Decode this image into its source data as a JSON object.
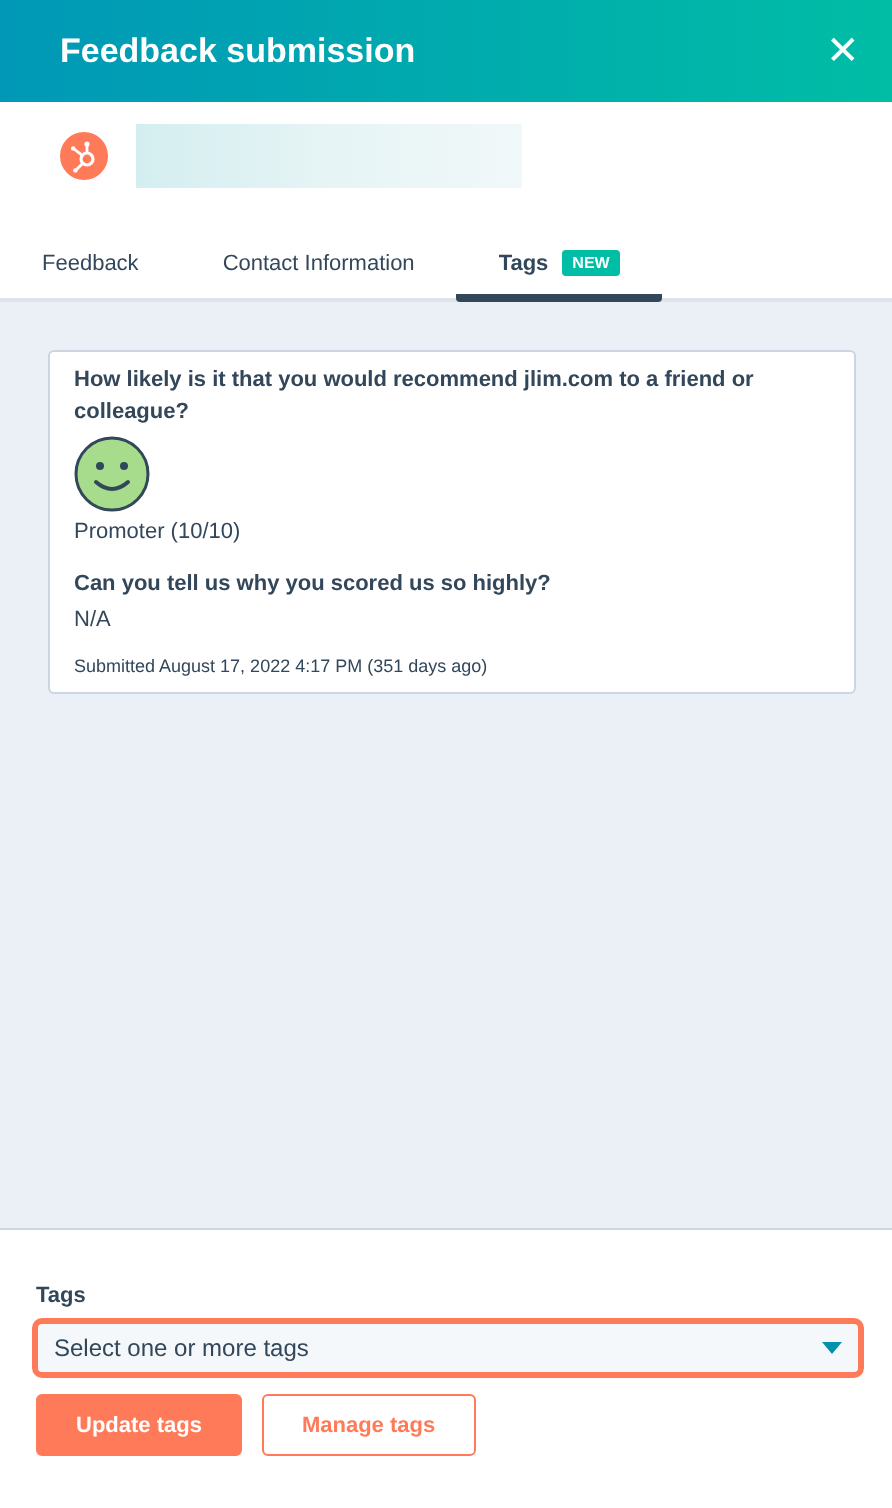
{
  "window": {
    "title": "Feedback submission",
    "close": "✕"
  },
  "tabs": [
    {
      "label": "Feedback",
      "selected": false
    },
    {
      "label": "Contact Information",
      "selected": false
    },
    {
      "label": "Tags",
      "selected": true,
      "badge": "NEW"
    }
  ],
  "submission": {
    "items": [
      {
        "question": "How likely is it that you would recommend jlim.com to a friend or colleague?",
        "answer": "Promoter (10/10)",
        "kind": "rating"
      },
      {
        "question": "Can you tell us why you scored us so highly?",
        "answer": "N/A",
        "kind": "text"
      }
    ],
    "submitted": "Submitted August 17, 2022 4:17 PM (351 days ago)"
  },
  "tags_field": {
    "label": "Tags",
    "placeholder": "Select one or more tags",
    "focused": true
  },
  "buttons": [
    {
      "label": "Update tags",
      "kind": "primary"
    },
    {
      "label": "Manage tags",
      "kind": "secondary"
    }
  ]
}
